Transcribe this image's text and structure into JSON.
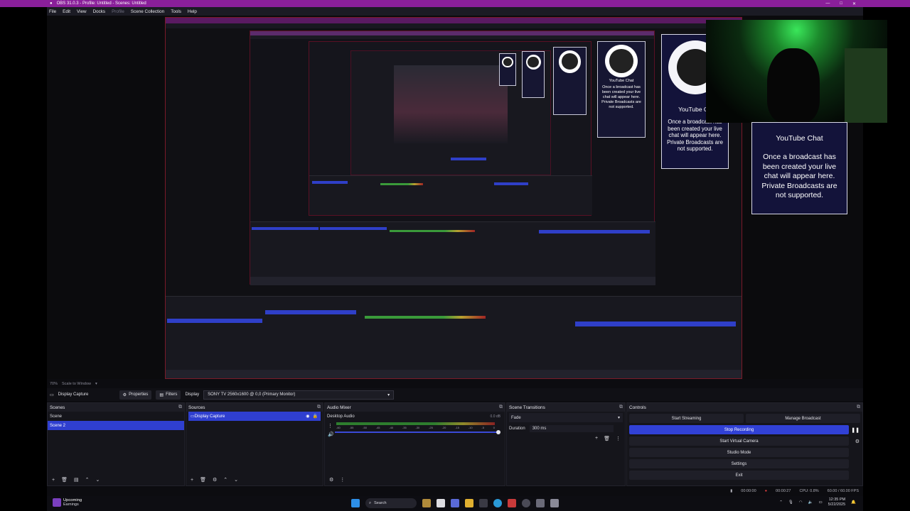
{
  "window": {
    "title": "OBS 31.0.3 - Profile: Untitled - Scenes: Untitled"
  },
  "menu": {
    "file": "File",
    "edit": "Edit",
    "view": "View",
    "docks": "Docks",
    "profile": "Profile",
    "scene_collection": "Scene Collection",
    "tools": "Tools",
    "help": "Help"
  },
  "preview": {
    "chat_title": "YouTube Chat",
    "chat_title_cut": "YouTube Ch",
    "chat_body": "Once a broadcast has been created your live chat will appear here. Private Broadcasts are not supported.",
    "chat_label": "Chat"
  },
  "scale": {
    "zoom": "70%",
    "label": "Scale to Window"
  },
  "source_bar": {
    "source_name": "Display Capture",
    "properties": "Properties",
    "filters": "Filters",
    "display_label": "Display",
    "display_value": "SONY TV 2560x1600 @ 0,0 (Primary Monitor)"
  },
  "scenes": {
    "title": "Scenes",
    "items": [
      "Scene",
      "Scene 2"
    ],
    "selected": 1
  },
  "sources": {
    "title": "Sources",
    "items": [
      "Display Capture"
    ]
  },
  "audio_mixer": {
    "title": "Audio Mixer",
    "track_name": "Desktop Audio",
    "level": "0.0 dB",
    "ticks": [
      "-60",
      "-55",
      "-50",
      "-45",
      "-40",
      "-35",
      "-30",
      "-25",
      "-20",
      "-15",
      "-10",
      "-5",
      "0"
    ]
  },
  "transitions": {
    "title": "Scene Transitions",
    "type": "Fade",
    "duration_label": "Duration",
    "duration_value": "300 ms"
  },
  "controls": {
    "title": "Controls",
    "start_streaming": "Start Streaming",
    "manage_broadcast": "Manage Broadcast",
    "stop_recording": "Stop Recording",
    "start_virtual_camera": "Start Virtual Camera",
    "studio_mode": "Studio Mode",
    "settings": "Settings",
    "exit": "Exit"
  },
  "status": {
    "stream_time": "00:00:00",
    "rec_time": "00:00:27",
    "cpu": "CPU: 0.8%",
    "fps": "60.00 / 60.00 FPS"
  },
  "taskbar": {
    "weather_title": "Upcoming",
    "weather_sub": "Earnings",
    "search": "Search",
    "time": "12:35 PM",
    "date": "5/22/2025"
  },
  "colors": {
    "accent": "#3141d6",
    "titlebar": "#8a1f9a",
    "record": "#e04040"
  }
}
